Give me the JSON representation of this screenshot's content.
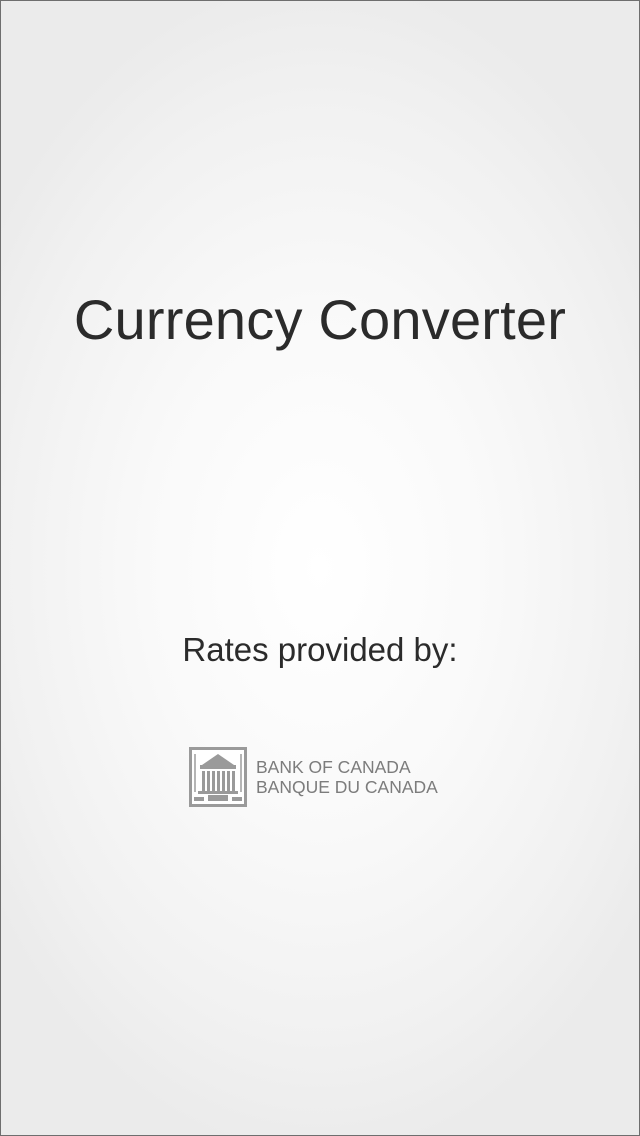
{
  "splash": {
    "title": "Currency Converter",
    "rates_label": "Rates provided by:",
    "provider": {
      "line1": "BANK OF CANADA",
      "line2": "BANQUE DU CANADA",
      "icon": "bank-building-icon"
    }
  },
  "colors": {
    "text": "#2b2b2b",
    "logo": "#7c7c7c",
    "background": "#f5f5f5",
    "border": "#6e6e6e"
  }
}
